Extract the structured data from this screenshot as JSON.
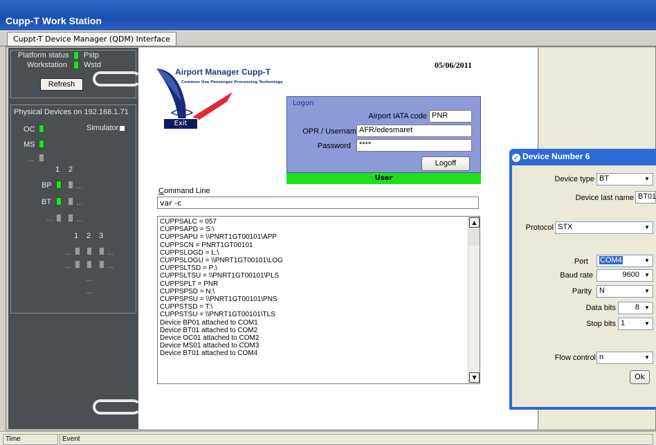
{
  "window": {
    "title": "Cupp-T Work Station"
  },
  "tab": {
    "label": "Cuppt-T Device Manager (QDM) Interface"
  },
  "status_panel": {
    "platform_label": "Platform status",
    "workstation_label": "Workstation",
    "pstp_label": "Pstp",
    "wstd_label": "Wstd",
    "refresh_label": "Refresh"
  },
  "devices_panel": {
    "title": "Physical Devices on 192.168.1.71",
    "oc_label": "OC",
    "ms_label": "MS",
    "simulator_label": "Simulator",
    "ellipsis": "...",
    "bp_label": "BP",
    "bt_label": "BT",
    "col1": "1",
    "col2": "2",
    "col3": "3"
  },
  "header": {
    "app_name": "Airport Manager Cupp-T",
    "app_subtitle": "Common Use Passenger Processing Technology",
    "date": "05/06/2011",
    "exit_label": "Exit"
  },
  "logon": {
    "title": "Logon",
    "iata_label": "Airport IATA code",
    "iata_value": "PNR",
    "username_label": "OPR / Username",
    "username_value": "AFR/edesmaret",
    "password_label": "Password",
    "password_value": "****",
    "logoff_label": "Logoff",
    "user_bar": "User"
  },
  "command": {
    "label_underlined": "C",
    "label_rest": "ommand Line",
    "value": "var -c"
  },
  "output": {
    "lines": [
      "CUPPSALC = 057",
      "CUPPSAPD = S:\\",
      "CUPPSAPU = \\\\PNRT1GT00101\\APP",
      "CUPPSCN = PNRT1GT00101",
      "CUPPSLOGD = L:\\",
      "CUPPSLOGU = \\\\PNRT1GT00101\\LOG",
      "CUPPSLTSD = P:\\",
      "CUPPSLTSU = \\\\PNRT1GT00101\\PLS",
      "CUPPSPLT = PNR",
      "CUPPSPSD = N:\\",
      "CUPPSPSU = \\\\PNRT1GT00101\\PNS",
      "CUPPSTSD = T:\\",
      "CUPPSTSU = \\\\PNRT1GT00101\\TLS",
      "Device BP01 attached to COM1",
      "Device BT01 attached to COM2",
      "Device OC01 attached to COM2",
      "Device MS01 attached to COM3",
      "Device BT01 attached to COM4"
    ]
  },
  "device_dialog": {
    "title": "Device Number 6",
    "device_type_label": "Device type",
    "device_type_value": "BT",
    "device_last_name_label": "Device last name",
    "device_last_name_value": "BT01",
    "protocol_label": "Protocol",
    "protocol_value": "STX",
    "port_label": "Port",
    "port_value": "COM4",
    "baud_label": "Baud rate",
    "baud_value": "9600",
    "parity_label": "Parity",
    "parity_value": "N",
    "data_bits_label": "Data bits",
    "data_bits_value": "8",
    "stop_bits_label": "Stop bits",
    "stop_bits_value": "1",
    "flow_control_label": "Flow control",
    "flow_control_value": "n",
    "ok_label": "Ok"
  },
  "status_bar": {
    "time_label": "Time",
    "event_label": "Event"
  },
  "colors": {
    "titlebar": "#1a4fb0",
    "led_on": "#2fd52f",
    "logon_bg": "#8c9ad8",
    "user_bar": "#1ee01e"
  }
}
